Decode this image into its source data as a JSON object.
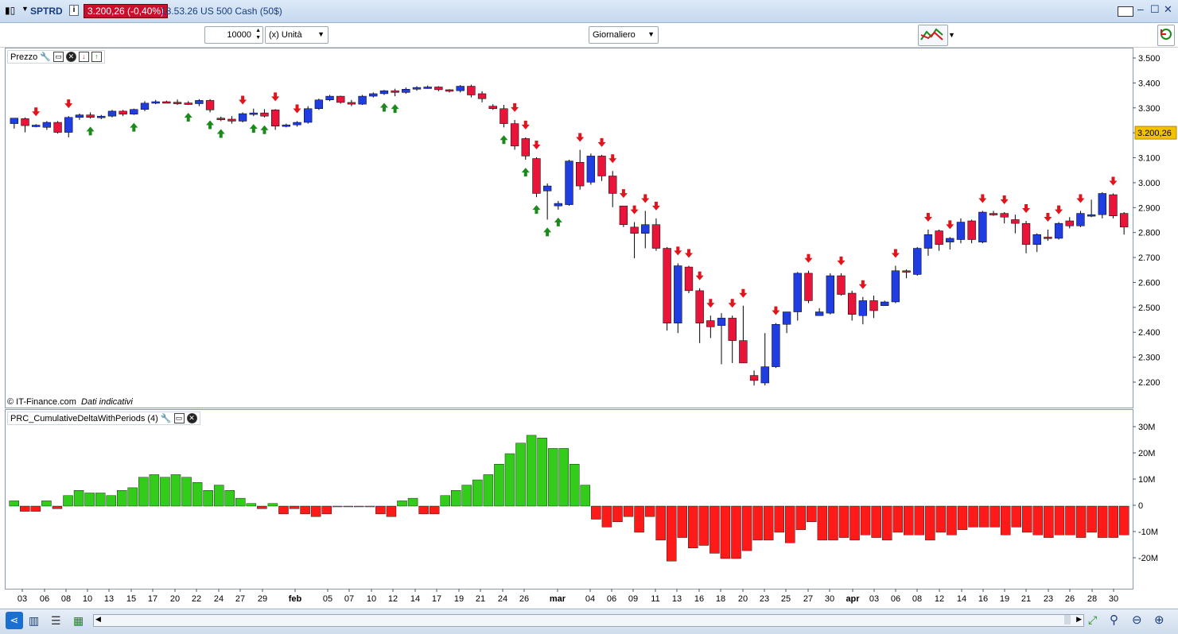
{
  "titlebar": {
    "symbol": "SPTRD",
    "price": "3.200,26 (-0,40%)",
    "instrument": "18.53.26 US 500 Cash (50$)"
  },
  "toolbar": {
    "quantity": "10000",
    "unit": "(x) Unità",
    "period": "Giornaliero"
  },
  "price_panel": {
    "label": "Prezzo",
    "copyright": "© IT-Finance.com",
    "note": "Dati indicativi",
    "y_ticks": [
      "3.500",
      "3.400",
      "3.300",
      "3.200",
      "3.100",
      "3.000",
      "2.900",
      "2.800",
      "2.700",
      "2.600",
      "2.500",
      "2.400",
      "2.300",
      "2.200"
    ],
    "current_price": "3.200,26"
  },
  "indicator_panel": {
    "label": "PRC_CumulativeDeltaWithPeriods (4)",
    "y_ticks": [
      "30M",
      "20M",
      "10M",
      "0",
      "-10M",
      "-20M"
    ]
  },
  "x_ticks": [
    "03",
    "06",
    "08",
    "10",
    "13",
    "15",
    "17",
    "20",
    "22",
    "24",
    "27",
    "29",
    "feb",
    "05",
    "07",
    "10",
    "12",
    "14",
    "17",
    "19",
    "21",
    "24",
    "26",
    "mar",
    "04",
    "06",
    "09",
    "11",
    "13",
    "16",
    "18",
    "20",
    "23",
    "25",
    "27",
    "30",
    "apr",
    "03",
    "06",
    "08",
    "12",
    "14",
    "16",
    "19",
    "21",
    "23",
    "26",
    "28",
    "30"
  ],
  "colors": {
    "up": "#1f3de0",
    "down": "#e8143a",
    "delta_pos": "#33cc1a",
    "delta_neg": "#ff1a1a",
    "up_arrow": "#1a8a1a",
    "down_arrow": "#e0141a"
  },
  "chart_data": {
    "type": "candlestick",
    "y_range": [
      2150,
      3550
    ],
    "candles": [
      {
        "o": 3240,
        "h": 3260,
        "l": 3220,
        "c": 3262
      },
      {
        "o": 3260,
        "h": 3265,
        "l": 3205,
        "c": 3232
      },
      {
        "o": 3232,
        "h": 3238,
        "l": 3225,
        "c": 3234
      },
      {
        "o": 3225,
        "h": 3250,
        "l": 3215,
        "c": 3245
      },
      {
        "o": 3245,
        "h": 3250,
        "l": 3200,
        "c": 3205
      },
      {
        "o": 3205,
        "h": 3270,
        "l": 3185,
        "c": 3265
      },
      {
        "o": 3265,
        "h": 3280,
        "l": 3255,
        "c": 3275
      },
      {
        "o": 3275,
        "h": 3285,
        "l": 3260,
        "c": 3265
      },
      {
        "o": 3265,
        "h": 3275,
        "l": 3258,
        "c": 3270
      },
      {
        "o": 3270,
        "h": 3295,
        "l": 3265,
        "c": 3290
      },
      {
        "o": 3290,
        "h": 3295,
        "l": 3270,
        "c": 3278
      },
      {
        "o": 3278,
        "h": 3300,
        "l": 3275,
        "c": 3297
      },
      {
        "o": 3297,
        "h": 3330,
        "l": 3290,
        "c": 3322
      },
      {
        "o": 3322,
        "h": 3335,
        "l": 3318,
        "c": 3328
      },
      {
        "o": 3328,
        "h": 3332,
        "l": 3322,
        "c": 3326
      },
      {
        "o": 3326,
        "h": 3337,
        "l": 3315,
        "c": 3323
      },
      {
        "o": 3323,
        "h": 3330,
        "l": 3315,
        "c": 3320
      },
      {
        "o": 3320,
        "h": 3338,
        "l": 3310,
        "c": 3333
      },
      {
        "o": 3333,
        "h": 3338,
        "l": 3285,
        "c": 3295
      },
      {
        "o": 3262,
        "h": 3268,
        "l": 3250,
        "c": 3258
      },
      {
        "o": 3258,
        "h": 3270,
        "l": 3240,
        "c": 3250
      },
      {
        "o": 3250,
        "h": 3285,
        "l": 3245,
        "c": 3280
      },
      {
        "o": 3280,
        "h": 3300,
        "l": 3270,
        "c": 3283
      },
      {
        "o": 3283,
        "h": 3298,
        "l": 3265,
        "c": 3270
      },
      {
        "o": 3295,
        "h": 3298,
        "l": 3215,
        "c": 3230
      },
      {
        "o": 3230,
        "h": 3240,
        "l": 3225,
        "c": 3235
      },
      {
        "o": 3235,
        "h": 3250,
        "l": 3228,
        "c": 3245
      },
      {
        "o": 3245,
        "h": 3310,
        "l": 3240,
        "c": 3300
      },
      {
        "o": 3300,
        "h": 3340,
        "l": 3295,
        "c": 3335
      },
      {
        "o": 3335,
        "h": 3355,
        "l": 3330,
        "c": 3350
      },
      {
        "o": 3350,
        "h": 3352,
        "l": 3320,
        "c": 3325
      },
      {
        "o": 3325,
        "h": 3335,
        "l": 3310,
        "c": 3318
      },
      {
        "o": 3318,
        "h": 3355,
        "l": 3315,
        "c": 3350
      },
      {
        "o": 3350,
        "h": 3365,
        "l": 3345,
        "c": 3360
      },
      {
        "o": 3360,
        "h": 3375,
        "l": 3355,
        "c": 3372
      },
      {
        "o": 3372,
        "h": 3380,
        "l": 3350,
        "c": 3365
      },
      {
        "o": 3365,
        "h": 3385,
        "l": 3360,
        "c": 3378
      },
      {
        "o": 3378,
        "h": 3390,
        "l": 3372,
        "c": 3385
      },
      {
        "o": 3385,
        "h": 3393,
        "l": 3380,
        "c": 3387
      },
      {
        "o": 3387,
        "h": 3390,
        "l": 3370,
        "c": 3376
      },
      {
        "o": 3376,
        "h": 3378,
        "l": 3365,
        "c": 3372
      },
      {
        "o": 3372,
        "h": 3395,
        "l": 3365,
        "c": 3390
      },
      {
        "o": 3390,
        "h": 3396,
        "l": 3345,
        "c": 3355
      },
      {
        "o": 3360,
        "h": 3370,
        "l": 3325,
        "c": 3340
      },
      {
        "o": 3310,
        "h": 3318,
        "l": 3295,
        "c": 3300
      },
      {
        "o": 3300,
        "h": 3315,
        "l": 3225,
        "c": 3240
      },
      {
        "o": 3240,
        "h": 3255,
        "l": 3135,
        "c": 3150
      },
      {
        "o": 3180,
        "h": 3185,
        "l": 3095,
        "c": 3110
      },
      {
        "o": 3100,
        "h": 3105,
        "l": 2945,
        "c": 2960
      },
      {
        "o": 2970,
        "h": 3000,
        "l": 2855,
        "c": 2990
      },
      {
        "o": 2910,
        "h": 2930,
        "l": 2895,
        "c": 2920
      },
      {
        "o": 2915,
        "h": 3095,
        "l": 2910,
        "c": 3090
      },
      {
        "o": 3085,
        "h": 3135,
        "l": 2975,
        "c": 2990
      },
      {
        "o": 3005,
        "h": 3120,
        "l": 2995,
        "c": 3110
      },
      {
        "o": 3110,
        "h": 3115,
        "l": 3010,
        "c": 3030
      },
      {
        "o": 3030,
        "h": 3050,
        "l": 2905,
        "c": 2960
      },
      {
        "o": 2910,
        "h": 2910,
        "l": 2825,
        "c": 2835
      },
      {
        "o": 2825,
        "h": 2845,
        "l": 2700,
        "c": 2800
      },
      {
        "o": 2800,
        "h": 2890,
        "l": 2740,
        "c": 2835
      },
      {
        "o": 2835,
        "h": 2860,
        "l": 2730,
        "c": 2740
      },
      {
        "o": 2740,
        "h": 2745,
        "l": 2410,
        "c": 2440
      },
      {
        "o": 2440,
        "h": 2680,
        "l": 2400,
        "c": 2670
      },
      {
        "o": 2665,
        "h": 2670,
        "l": 2560,
        "c": 2570
      },
      {
        "o": 2570,
        "h": 2580,
        "l": 2360,
        "c": 2440
      },
      {
        "o": 2450,
        "h": 2470,
        "l": 2380,
        "c": 2425
      },
      {
        "o": 2430,
        "h": 2480,
        "l": 2275,
        "c": 2460
      },
      {
        "o": 2460,
        "h": 2470,
        "l": 2280,
        "c": 2370
      },
      {
        "o": 2370,
        "h": 2510,
        "l": 2280,
        "c": 2280
      },
      {
        "o": 2230,
        "h": 2250,
        "l": 2190,
        "c": 2210
      },
      {
        "o": 2200,
        "h": 2400,
        "l": 2190,
        "c": 2265
      },
      {
        "o": 2265,
        "h": 2440,
        "l": 2260,
        "c": 2435
      },
      {
        "o": 2435,
        "h": 2485,
        "l": 2400,
        "c": 2485
      },
      {
        "o": 2485,
        "h": 2645,
        "l": 2450,
        "c": 2640
      },
      {
        "o": 2640,
        "h": 2650,
        "l": 2520,
        "c": 2530
      },
      {
        "o": 2470,
        "h": 2500,
        "l": 2470,
        "c": 2485
      },
      {
        "o": 2480,
        "h": 2640,
        "l": 2475,
        "c": 2630
      },
      {
        "o": 2630,
        "h": 2640,
        "l": 2550,
        "c": 2555
      },
      {
        "o": 2560,
        "h": 2570,
        "l": 2450,
        "c": 2475
      },
      {
        "o": 2470,
        "h": 2545,
        "l": 2435,
        "c": 2530
      },
      {
        "o": 2530,
        "h": 2550,
        "l": 2460,
        "c": 2490
      },
      {
        "o": 2510,
        "h": 2530,
        "l": 2510,
        "c": 2525
      },
      {
        "o": 2525,
        "h": 2670,
        "l": 2520,
        "c": 2650
      },
      {
        "o": 2650,
        "h": 2655,
        "l": 2620,
        "c": 2645
      },
      {
        "o": 2635,
        "h": 2745,
        "l": 2630,
        "c": 2740
      },
      {
        "o": 2740,
        "h": 2815,
        "l": 2710,
        "c": 2795
      },
      {
        "o": 2810,
        "h": 2815,
        "l": 2730,
        "c": 2755
      },
      {
        "o": 2765,
        "h": 2785,
        "l": 2735,
        "c": 2780
      },
      {
        "o": 2775,
        "h": 2860,
        "l": 2760,
        "c": 2845
      },
      {
        "o": 2850,
        "h": 2855,
        "l": 2760,
        "c": 2775
      },
      {
        "o": 2765,
        "h": 2890,
        "l": 2760,
        "c": 2885
      },
      {
        "o": 2880,
        "h": 2890,
        "l": 2870,
        "c": 2875
      },
      {
        "o": 2880,
        "h": 2885,
        "l": 2840,
        "c": 2865
      },
      {
        "o": 2855,
        "h": 2875,
        "l": 2800,
        "c": 2840
      },
      {
        "o": 2840,
        "h": 2850,
        "l": 2720,
        "c": 2755
      },
      {
        "o": 2755,
        "h": 2800,
        "l": 2725,
        "c": 2795
      },
      {
        "o": 2785,
        "h": 2815,
        "l": 2770,
        "c": 2780
      },
      {
        "o": 2780,
        "h": 2845,
        "l": 2775,
        "c": 2840
      },
      {
        "o": 2850,
        "h": 2865,
        "l": 2820,
        "c": 2830
      },
      {
        "o": 2830,
        "h": 2890,
        "l": 2825,
        "c": 2880
      },
      {
        "o": 2870,
        "h": 2935,
        "l": 2865,
        "c": 2875
      },
      {
        "o": 2875,
        "h": 2965,
        "l": 2860,
        "c": 2960
      },
      {
        "o": 2955,
        "h": 2960,
        "l": 2860,
        "c": 2870
      },
      {
        "o": 2880,
        "h": 2885,
        "l": 2795,
        "c": 2825
      }
    ],
    "delta": [
      2,
      -2,
      -2,
      2,
      -1,
      4,
      6,
      5,
      5,
      4,
      6,
      7,
      11,
      12,
      11,
      12,
      11,
      9,
      6,
      8,
      6,
      3,
      1,
      -1,
      1,
      -3,
      -1,
      -3,
      -4,
      -3,
      0,
      0,
      0,
      0,
      -3,
      -4,
      2,
      3,
      -3,
      -3,
      4,
      6,
      8,
      10,
      12,
      16,
      20,
      24,
      27,
      26,
      22,
      22,
      16,
      8,
      -5,
      -8,
      -6,
      -4,
      -10,
      -4,
      -13,
      -21,
      -12,
      -16,
      -15,
      -18,
      -20,
      -20,
      -17,
      -13,
      -13,
      -10,
      -14,
      -9,
      -6,
      -13,
      -13,
      -12,
      -13,
      -11,
      -12,
      -13,
      -10,
      -11,
      -11,
      -13,
      -10,
      -11,
      -9,
      -8,
      -8,
      -8,
      -11,
      -8,
      -10,
      -11,
      -12,
      -11,
      -11,
      -12,
      -10,
      -12,
      -12,
      -11
    ],
    "up_arrows": [
      7,
      11,
      16,
      18,
      19,
      22,
      23,
      34,
      35,
      45,
      47,
      48,
      49,
      50
    ],
    "down_arrows": [
      2,
      5,
      21,
      24,
      26,
      46,
      47,
      48,
      52,
      54,
      55,
      56,
      57,
      58,
      59,
      61,
      62,
      63,
      64,
      66,
      67,
      70,
      73,
      76,
      78,
      81,
      84,
      86,
      89,
      91,
      93,
      95,
      96,
      98,
      101
    ]
  }
}
